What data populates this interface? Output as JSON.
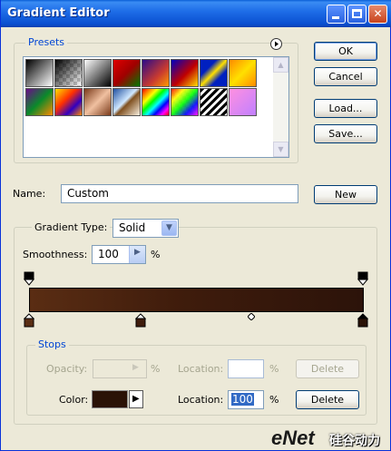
{
  "window": {
    "title": "Gradient Editor",
    "colors": {
      "titlebar": "#0a4fd0",
      "face": "#ece9d8",
      "accent_label": "#0046d5"
    }
  },
  "buttons": {
    "ok": "OK",
    "cancel": "Cancel",
    "load": "Load...",
    "save": "Save...",
    "new": "New"
  },
  "presets": {
    "label": "Presets",
    "menu_icon": "circle-arrow-icon",
    "swatches_row1": [
      "black-to-white",
      "transparent-checker",
      "black-to-white-2",
      "red-green",
      "violet-orange",
      "blue-red-yellow",
      "blue-yellow-blue",
      "orange-yellow-orange"
    ],
    "swatches_row2": [
      "violet-green-orange",
      "rainbow-yellow",
      "copper",
      "chrome",
      "spectrum",
      "transparent-rainbow",
      "transparent-stripes",
      "pink-violet"
    ]
  },
  "name": {
    "label": "Name:",
    "value": "Custom"
  },
  "gradient": {
    "type_label": "Gradient Type:",
    "type_value": "Solid",
    "smoothness_label": "Smoothness:",
    "smoothness_value": "100",
    "percent": "%",
    "start_color": "#5a2d13",
    "end_color": "#2c130a",
    "midpoint": 0.66
  },
  "stops": {
    "label": "Stops",
    "opacity_label": "Opacity:",
    "opacity_percent": "%",
    "location_label_1": "Location:",
    "location_percent_1": "%",
    "delete_1": "Delete",
    "color_label": "Color:",
    "color_value": "#2a1206",
    "location_label_2": "Location:",
    "location_value_2": "100",
    "location_percent_2": "%",
    "delete_2": "Delete"
  },
  "watermark": {
    "text": "eNet",
    "sub": "硅谷动力"
  }
}
